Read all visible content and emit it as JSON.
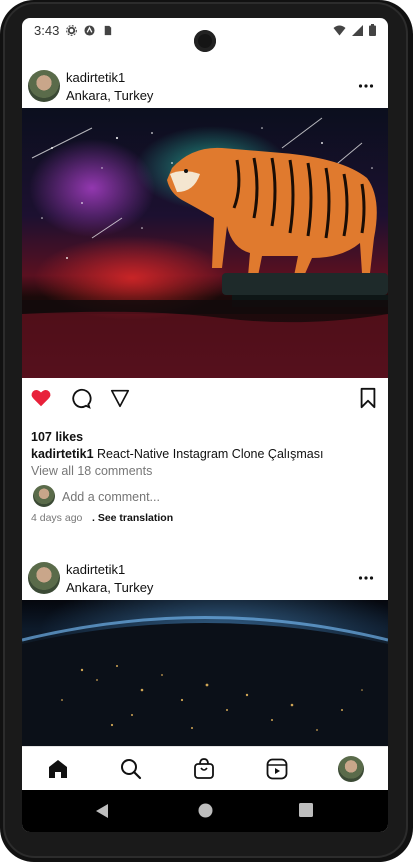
{
  "status_bar": {
    "time": "3:43"
  },
  "posts": [
    {
      "username": "kadirtetik1",
      "location": "Ankara, Turkey",
      "likes": "107 likes",
      "caption_user": "kadirtetik1",
      "caption_text": "React-Native Instagram Clone Çalışması",
      "view_comments": "View all 18 comments",
      "time_ago": "4 days ago",
      "see_translation": ". See translation"
    },
    {
      "username": "kadirtetik1",
      "location": "Ankara, Turkey"
    }
  ],
  "comment": {
    "placeholder": "Add a comment..."
  },
  "colors": {
    "like_red": "#e8213a",
    "text": "#111111",
    "muted": "#777777"
  },
  "icons": {
    "actions": [
      "heart-icon",
      "comment-icon",
      "share-icon",
      "bookmark-icon"
    ],
    "tabs": [
      "home-icon",
      "search-icon",
      "shop-icon",
      "reels-icon",
      "profile-avatar"
    ],
    "nav": [
      "back-icon",
      "home-circle-icon",
      "recents-icon"
    ]
  }
}
